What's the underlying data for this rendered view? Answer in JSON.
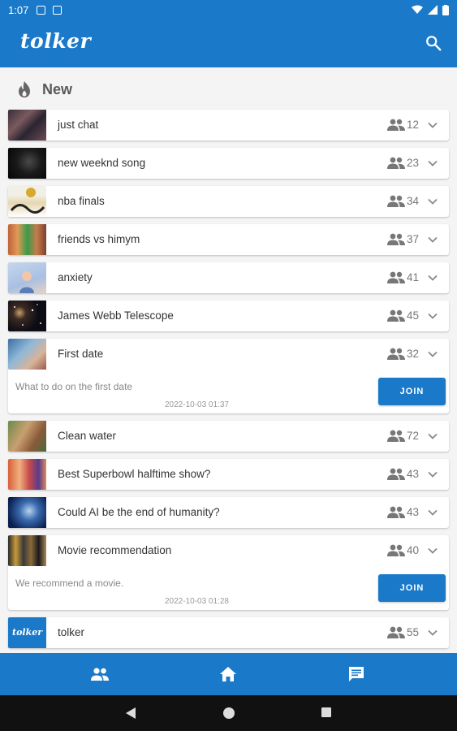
{
  "status_bar": {
    "time": "1:07"
  },
  "app": {
    "title": "tolker"
  },
  "section": {
    "title": "New"
  },
  "chats": [
    {
      "name": "just chat",
      "count": "12",
      "expanded": false
    },
    {
      "name": "new weeknd song",
      "count": "23",
      "expanded": false
    },
    {
      "name": "nba finals",
      "count": "34",
      "expanded": false
    },
    {
      "name": "friends vs himym",
      "count": "37",
      "expanded": false
    },
    {
      "name": "anxiety",
      "count": "41",
      "expanded": false
    },
    {
      "name": "James Webb Telescope",
      "count": "45",
      "expanded": false
    },
    {
      "name": "First date",
      "count": "32",
      "expanded": true,
      "description": "What to do on the first date",
      "time": "2022-10-03 01:37",
      "join_label": "JOIN"
    },
    {
      "name": "Clean water",
      "count": "72",
      "expanded": false
    },
    {
      "name": "Best Superbowl halftime show?",
      "count": "43",
      "expanded": false
    },
    {
      "name": "Could AI be the end of humanity?",
      "count": "43",
      "expanded": false
    },
    {
      "name": "Movie recommendation",
      "count": "40",
      "expanded": true,
      "description": "We recommend a movie.",
      "time": "2022-10-03 01:28",
      "join_label": "JOIN"
    },
    {
      "name": "tolker",
      "count": "55",
      "expanded": false,
      "thumb_logo": "tolker"
    }
  ],
  "bottom_nav": [
    {
      "icon": "people-icon"
    },
    {
      "icon": "home-icon"
    },
    {
      "icon": "chat-icon"
    }
  ],
  "colors": {
    "primary": "#1a7ac9",
    "background": "#f4f4f4"
  }
}
